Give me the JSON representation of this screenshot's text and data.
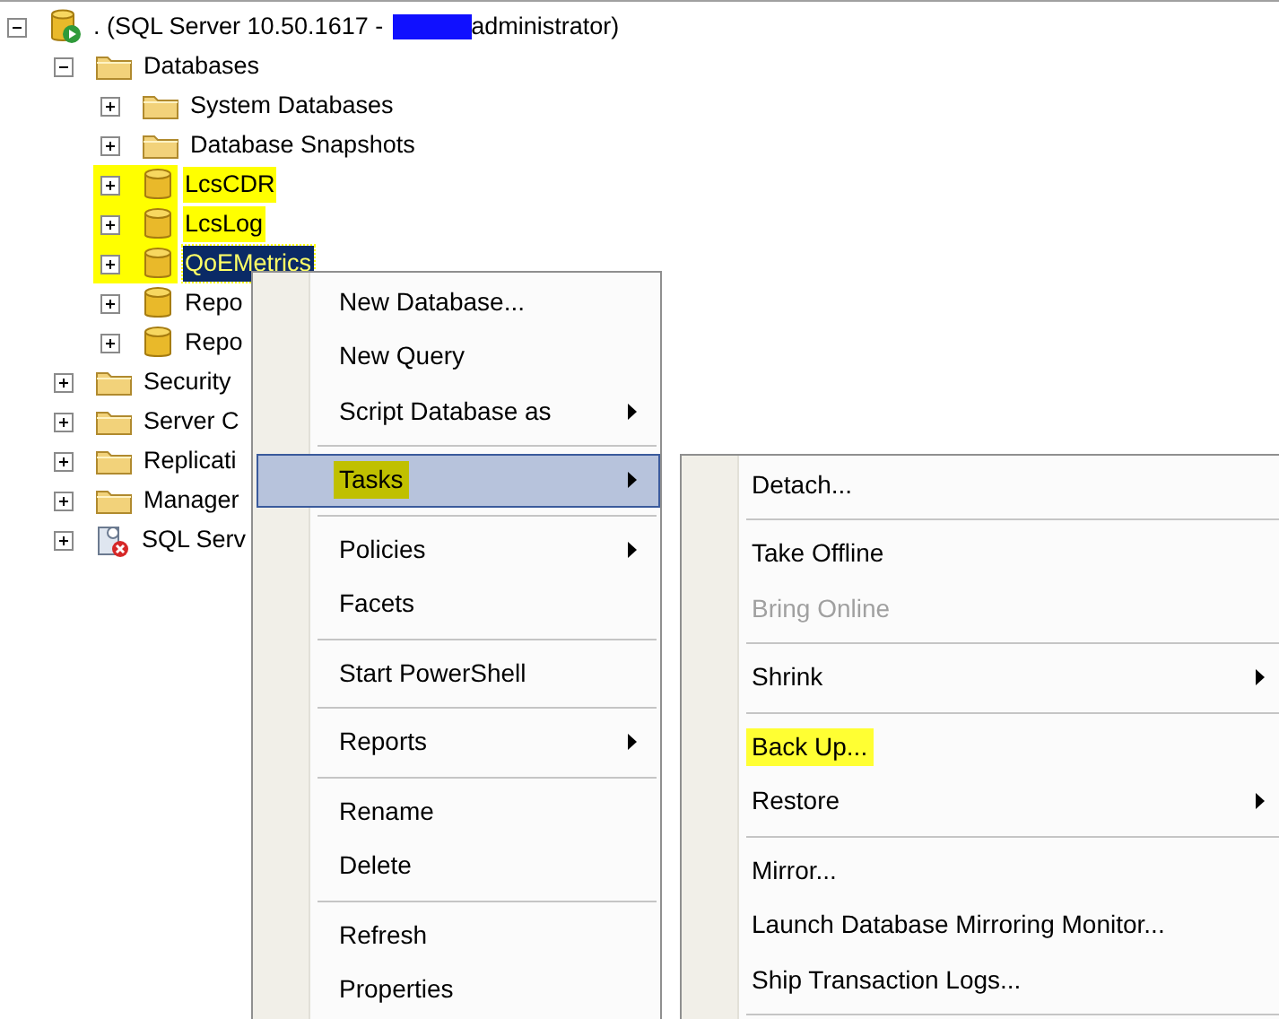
{
  "tree": [
    {
      "label": ". (SQL Server 10.50.1617 -",
      "redacted": true,
      "label_suffix": "administrator)",
      "kind": "server",
      "expanded": true,
      "highlighted": false,
      "selected": false,
      "children": [
        {
          "label": "Databases",
          "kind": "folder",
          "expanded": true,
          "highlighted": false,
          "selected": false,
          "children": [
            {
              "label": "System Databases",
              "kind": "folder",
              "expanded": false,
              "highlighted": false,
              "selected": false
            },
            {
              "label": "Database Snapshots",
              "kind": "folder",
              "expanded": false,
              "highlighted": false,
              "selected": false
            },
            {
              "label": "LcsCDR",
              "kind": "database",
              "expanded": false,
              "highlighted": true,
              "selected": false
            },
            {
              "label": "LcsLog",
              "kind": "database",
              "expanded": false,
              "highlighted": true,
              "selected": false
            },
            {
              "label": "QoEMetrics",
              "kind": "database",
              "expanded": false,
              "highlighted": true,
              "selected": true
            },
            {
              "label": "Repo",
              "kind": "database",
              "expanded": false,
              "highlighted": false,
              "selected": false
            },
            {
              "label": "Repo",
              "kind": "database",
              "expanded": false,
              "highlighted": false,
              "selected": false
            }
          ]
        },
        {
          "label": "Security",
          "kind": "folder",
          "expanded": false,
          "highlighted": false,
          "selected": false
        },
        {
          "label": "Server C",
          "kind": "folder",
          "expanded": false,
          "highlighted": false,
          "selected": false
        },
        {
          "label": "Replicati",
          "kind": "folder",
          "expanded": false,
          "highlighted": false,
          "selected": false
        },
        {
          "label": "Manager",
          "kind": "folder",
          "expanded": false,
          "highlighted": false,
          "selected": false
        },
        {
          "label": "SQL Serv",
          "kind": "agent",
          "expanded": false,
          "highlighted": false,
          "selected": false
        }
      ]
    }
  ],
  "context_menu": [
    {
      "kind": "item",
      "label": "New Database...",
      "submenu": false,
      "selected": false,
      "highlighted": false,
      "disabled": false
    },
    {
      "kind": "item",
      "label": "New Query",
      "submenu": false,
      "selected": false,
      "highlighted": false,
      "disabled": false
    },
    {
      "kind": "item",
      "label": "Script Database as",
      "submenu": true,
      "selected": false,
      "highlighted": false,
      "disabled": false
    },
    {
      "kind": "separator"
    },
    {
      "kind": "item",
      "label": "Tasks",
      "submenu": true,
      "selected": true,
      "highlighted": true,
      "disabled": false
    },
    {
      "kind": "separator"
    },
    {
      "kind": "item",
      "label": "Policies",
      "submenu": true,
      "selected": false,
      "highlighted": false,
      "disabled": false
    },
    {
      "kind": "item",
      "label": "Facets",
      "submenu": false,
      "selected": false,
      "highlighted": false,
      "disabled": false
    },
    {
      "kind": "separator"
    },
    {
      "kind": "item",
      "label": "Start PowerShell",
      "submenu": false,
      "selected": false,
      "highlighted": false,
      "disabled": false
    },
    {
      "kind": "separator"
    },
    {
      "kind": "item",
      "label": "Reports",
      "submenu": true,
      "selected": false,
      "highlighted": false,
      "disabled": false
    },
    {
      "kind": "separator"
    },
    {
      "kind": "item",
      "label": "Rename",
      "submenu": false,
      "selected": false,
      "highlighted": false,
      "disabled": false
    },
    {
      "kind": "item",
      "label": "Delete",
      "submenu": false,
      "selected": false,
      "highlighted": false,
      "disabled": false
    },
    {
      "kind": "separator"
    },
    {
      "kind": "item",
      "label": "Refresh",
      "submenu": false,
      "selected": false,
      "highlighted": false,
      "disabled": false
    },
    {
      "kind": "item",
      "label": "Properties",
      "submenu": false,
      "selected": false,
      "highlighted": false,
      "disabled": false
    }
  ],
  "tasks_submenu": [
    {
      "kind": "item",
      "label": "Detach...",
      "submenu": false,
      "selected": false,
      "highlighted": false,
      "disabled": false
    },
    {
      "kind": "separator"
    },
    {
      "kind": "item",
      "label": "Take Offline",
      "submenu": false,
      "selected": false,
      "highlighted": false,
      "disabled": false
    },
    {
      "kind": "item",
      "label": "Bring Online",
      "submenu": false,
      "selected": false,
      "highlighted": false,
      "disabled": true
    },
    {
      "kind": "separator"
    },
    {
      "kind": "item",
      "label": "Shrink",
      "submenu": true,
      "selected": false,
      "highlighted": false,
      "disabled": false
    },
    {
      "kind": "separator"
    },
    {
      "kind": "item",
      "label": "Back Up...",
      "submenu": false,
      "selected": false,
      "highlighted": true,
      "disabled": false
    },
    {
      "kind": "item",
      "label": "Restore",
      "submenu": true,
      "selected": false,
      "highlighted": false,
      "disabled": false
    },
    {
      "kind": "separator"
    },
    {
      "kind": "item",
      "label": "Mirror...",
      "submenu": false,
      "selected": false,
      "highlighted": false,
      "disabled": false
    },
    {
      "kind": "item",
      "label": "Launch Database Mirroring Monitor...",
      "submenu": false,
      "selected": false,
      "highlighted": false,
      "disabled": false
    },
    {
      "kind": "item",
      "label": "Ship Transaction Logs...",
      "submenu": false,
      "selected": false,
      "highlighted": false,
      "disabled": false
    },
    {
      "kind": "separator"
    }
  ]
}
